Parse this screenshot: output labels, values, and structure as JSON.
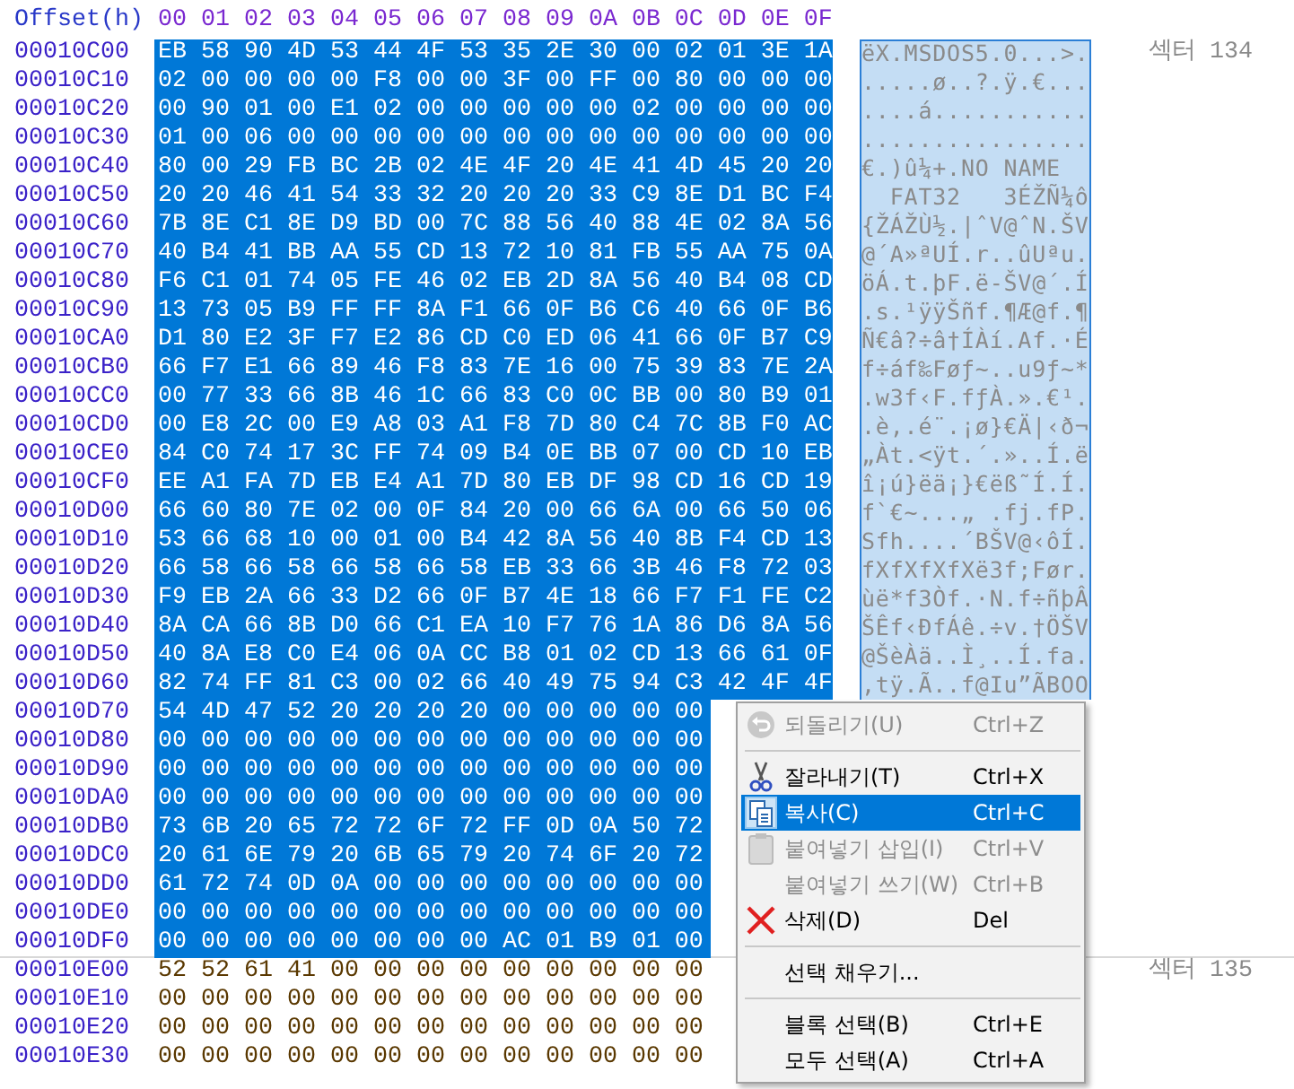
{
  "header": {
    "offset_label": "Offset(h)",
    "columns": [
      "00",
      "01",
      "02",
      "03",
      "04",
      "05",
      "06",
      "07",
      "08",
      "09",
      "0A",
      "0B",
      "0C",
      "0D",
      "0E",
      "0F"
    ]
  },
  "rows": [
    {
      "offset": "00010C00",
      "hex": [
        "EB",
        "58",
        "90",
        "4D",
        "53",
        "44",
        "4F",
        "53",
        "35",
        "2E",
        "30",
        "00",
        "02",
        "01",
        "3E",
        "1A"
      ],
      "ascii": "ëX.MSDOS5.0...>.",
      "selected": true,
      "sector": "섹터 134"
    },
    {
      "offset": "00010C10",
      "hex": [
        "02",
        "00",
        "00",
        "00",
        "00",
        "F8",
        "00",
        "00",
        "3F",
        "00",
        "FF",
        "00",
        "80",
        "00",
        "00",
        "00"
      ],
      "ascii": ".....ø..?.ÿ.€...",
      "selected": true
    },
    {
      "offset": "00010C20",
      "hex": [
        "00",
        "90",
        "01",
        "00",
        "E1",
        "02",
        "00",
        "00",
        "00",
        "00",
        "00",
        "02",
        "00",
        "00",
        "00",
        "00"
      ],
      "ascii": "....á...........",
      "selected": true
    },
    {
      "offset": "00010C30",
      "hex": [
        "01",
        "00",
        "06",
        "00",
        "00",
        "00",
        "00",
        "00",
        "00",
        "00",
        "00",
        "00",
        "00",
        "00",
        "00",
        "00"
      ],
      "ascii": "................",
      "selected": true
    },
    {
      "offset": "00010C40",
      "hex": [
        "80",
        "00",
        "29",
        "FB",
        "BC",
        "2B",
        "02",
        "4E",
        "4F",
        "20",
        "4E",
        "41",
        "4D",
        "45",
        "20",
        "20"
      ],
      "ascii": "€.)û¼+.NO NAME  ",
      "selected": true
    },
    {
      "offset": "00010C50",
      "hex": [
        "20",
        "20",
        "46",
        "41",
        "54",
        "33",
        "32",
        "20",
        "20",
        "20",
        "33",
        "C9",
        "8E",
        "D1",
        "BC",
        "F4"
      ],
      "ascii": "  FAT32   3ÉŽÑ¼ô",
      "selected": true
    },
    {
      "offset": "00010C60",
      "hex": [
        "7B",
        "8E",
        "C1",
        "8E",
        "D9",
        "BD",
        "00",
        "7C",
        "88",
        "56",
        "40",
        "88",
        "4E",
        "02",
        "8A",
        "56"
      ],
      "ascii": "{ŽÁŽÙ½.|ˆV@ˆN.ŠV",
      "selected": true
    },
    {
      "offset": "00010C70",
      "hex": [
        "40",
        "B4",
        "41",
        "BB",
        "AA",
        "55",
        "CD",
        "13",
        "72",
        "10",
        "81",
        "FB",
        "55",
        "AA",
        "75",
        "0A"
      ],
      "ascii": "@´A»ªUÍ.r..ûUªu.",
      "selected": true
    },
    {
      "offset": "00010C80",
      "hex": [
        "F6",
        "C1",
        "01",
        "74",
        "05",
        "FE",
        "46",
        "02",
        "EB",
        "2D",
        "8A",
        "56",
        "40",
        "B4",
        "08",
        "CD"
      ],
      "ascii": "öÁ.t.þF.ë-ŠV@´.Í",
      "selected": true
    },
    {
      "offset": "00010C90",
      "hex": [
        "13",
        "73",
        "05",
        "B9",
        "FF",
        "FF",
        "8A",
        "F1",
        "66",
        "0F",
        "B6",
        "C6",
        "40",
        "66",
        "0F",
        "B6"
      ],
      "ascii": ".s.¹ÿÿŠñf.¶Æ@f.¶",
      "selected": true
    },
    {
      "offset": "00010CA0",
      "hex": [
        "D1",
        "80",
        "E2",
        "3F",
        "F7",
        "E2",
        "86",
        "CD",
        "C0",
        "ED",
        "06",
        "41",
        "66",
        "0F",
        "B7",
        "C9"
      ],
      "ascii": "Ñ€â?÷â†ÍÀí.Af.·É",
      "selected": true
    },
    {
      "offset": "00010CB0",
      "hex": [
        "66",
        "F7",
        "E1",
        "66",
        "89",
        "46",
        "F8",
        "83",
        "7E",
        "16",
        "00",
        "75",
        "39",
        "83",
        "7E",
        "2A"
      ],
      "ascii": "f÷áf‰Føƒ~..u9ƒ~*",
      "selected": true
    },
    {
      "offset": "00010CC0",
      "hex": [
        "00",
        "77",
        "33",
        "66",
        "8B",
        "46",
        "1C",
        "66",
        "83",
        "C0",
        "0C",
        "BB",
        "00",
        "80",
        "B9",
        "01"
      ],
      "ascii": ".w3f‹F.fƒÀ.».€¹.",
      "selected": true
    },
    {
      "offset": "00010CD0",
      "hex": [
        "00",
        "E8",
        "2C",
        "00",
        "E9",
        "A8",
        "03",
        "A1",
        "F8",
        "7D",
        "80",
        "C4",
        "7C",
        "8B",
        "F0",
        "AC"
      ],
      "ascii": ".è,.é¨.¡ø}€Ä|‹ð¬",
      "selected": true
    },
    {
      "offset": "00010CE0",
      "hex": [
        "84",
        "C0",
        "74",
        "17",
        "3C",
        "FF",
        "74",
        "09",
        "B4",
        "0E",
        "BB",
        "07",
        "00",
        "CD",
        "10",
        "EB"
      ],
      "ascii": "„Àt.<ÿt.´.»..Í.ë",
      "selected": true
    },
    {
      "offset": "00010CF0",
      "hex": [
        "EE",
        "A1",
        "FA",
        "7D",
        "EB",
        "E4",
        "A1",
        "7D",
        "80",
        "EB",
        "DF",
        "98",
        "CD",
        "16",
        "CD",
        "19"
      ],
      "ascii": "î¡ú}ëä¡}€ëß˜Í.Í.",
      "selected": true
    },
    {
      "offset": "00010D00",
      "hex": [
        "66",
        "60",
        "80",
        "7E",
        "02",
        "00",
        "0F",
        "84",
        "20",
        "00",
        "66",
        "6A",
        "00",
        "66",
        "50",
        "06"
      ],
      "ascii": "f`€~...„ .fj.fP.",
      "selected": true
    },
    {
      "offset": "00010D10",
      "hex": [
        "53",
        "66",
        "68",
        "10",
        "00",
        "01",
        "00",
        "B4",
        "42",
        "8A",
        "56",
        "40",
        "8B",
        "F4",
        "CD",
        "13"
      ],
      "ascii": "Sfh....´BŠV@‹ôÍ.",
      "selected": true
    },
    {
      "offset": "00010D20",
      "hex": [
        "66",
        "58",
        "66",
        "58",
        "66",
        "58",
        "66",
        "58",
        "EB",
        "33",
        "66",
        "3B",
        "46",
        "F8",
        "72",
        "03"
      ],
      "ascii": "fXfXfXfXë3f;Før.",
      "selected": true
    },
    {
      "offset": "00010D30",
      "hex": [
        "F9",
        "EB",
        "2A",
        "66",
        "33",
        "D2",
        "66",
        "0F",
        "B7",
        "4E",
        "18",
        "66",
        "F7",
        "F1",
        "FE",
        "C2"
      ],
      "ascii": "ùë*f3Òf.·N.f÷ñþÂ",
      "selected": true
    },
    {
      "offset": "00010D40",
      "hex": [
        "8A",
        "CA",
        "66",
        "8B",
        "D0",
        "66",
        "C1",
        "EA",
        "10",
        "F7",
        "76",
        "1A",
        "86",
        "D6",
        "8A",
        "56"
      ],
      "ascii": "ŠÊf‹ÐfÁê.÷v.†ÖŠV",
      "selected": true
    },
    {
      "offset": "00010D50",
      "hex": [
        "40",
        "8A",
        "E8",
        "C0",
        "E4",
        "06",
        "0A",
        "CC",
        "B8",
        "01",
        "02",
        "CD",
        "13",
        "66",
        "61",
        "0F"
      ],
      "ascii": "@ŠèÀä..Ì¸..Í.fa.",
      "selected": true
    },
    {
      "offset": "00010D60",
      "hex": [
        "82",
        "74",
        "FF",
        "81",
        "C3",
        "00",
        "02",
        "66",
        "40",
        "49",
        "75",
        "94",
        "C3",
        "42",
        "4F",
        "4F"
      ],
      "ascii": "‚tÿ.Ã..f@Iu”ÃBOO",
      "selected": true
    },
    {
      "offset": "00010D70",
      "hex": [
        "54",
        "4D",
        "47",
        "52",
        "20",
        "20",
        "20",
        "20",
        "00",
        "00",
        "00",
        "00",
        "00"
      ],
      "selected": true
    },
    {
      "offset": "00010D80",
      "hex": [
        "00",
        "00",
        "00",
        "00",
        "00",
        "00",
        "00",
        "00",
        "00",
        "00",
        "00",
        "00",
        "00"
      ],
      "selected": true
    },
    {
      "offset": "00010D90",
      "hex": [
        "00",
        "00",
        "00",
        "00",
        "00",
        "00",
        "00",
        "00",
        "00",
        "00",
        "00",
        "00",
        "00"
      ],
      "selected": true
    },
    {
      "offset": "00010DA0",
      "hex": [
        "00",
        "00",
        "00",
        "00",
        "00",
        "00",
        "00",
        "00",
        "00",
        "00",
        "00",
        "00",
        "00"
      ],
      "selected": true
    },
    {
      "offset": "00010DB0",
      "hex": [
        "73",
        "6B",
        "20",
        "65",
        "72",
        "72",
        "6F",
        "72",
        "FF",
        "0D",
        "0A",
        "50",
        "72"
      ],
      "selected": true
    },
    {
      "offset": "00010DC0",
      "hex": [
        "20",
        "61",
        "6E",
        "79",
        "20",
        "6B",
        "65",
        "79",
        "20",
        "74",
        "6F",
        "20",
        "72"
      ],
      "selected": true
    },
    {
      "offset": "00010DD0",
      "hex": [
        "61",
        "72",
        "74",
        "0D",
        "0A",
        "00",
        "00",
        "00",
        "00",
        "00",
        "00",
        "00",
        "00"
      ],
      "selected": true
    },
    {
      "offset": "00010DE0",
      "hex": [
        "00",
        "00",
        "00",
        "00",
        "00",
        "00",
        "00",
        "00",
        "00",
        "00",
        "00",
        "00",
        "00"
      ],
      "selected": true
    },
    {
      "offset": "00010DF0",
      "hex": [
        "00",
        "00",
        "00",
        "00",
        "00",
        "00",
        "00",
        "00",
        "AC",
        "01",
        "B9",
        "01",
        "00"
      ],
      "selected": true
    },
    {
      "offset": "00010E00",
      "hex": [
        "52",
        "52",
        "61",
        "41",
        "00",
        "00",
        "00",
        "00",
        "00",
        "00",
        "00",
        "00",
        "00"
      ],
      "selected": false,
      "sector": "섹터 135"
    },
    {
      "offset": "00010E10",
      "hex": [
        "00",
        "00",
        "00",
        "00",
        "00",
        "00",
        "00",
        "00",
        "00",
        "00",
        "00",
        "00",
        "00"
      ],
      "selected": false
    },
    {
      "offset": "00010E20",
      "hex": [
        "00",
        "00",
        "00",
        "00",
        "00",
        "00",
        "00",
        "00",
        "00",
        "00",
        "00",
        "00",
        "00"
      ],
      "selected": false
    },
    {
      "offset": "00010E30",
      "hex": [
        "00",
        "00",
        "00",
        "00",
        "00",
        "00",
        "00",
        "00",
        "00",
        "00",
        "00",
        "00",
        "00"
      ],
      "selected": false
    }
  ],
  "context_menu": {
    "items": [
      {
        "kind": "item",
        "label": "되돌리기(U)",
        "shortcut": "Ctrl+Z",
        "disabled": true,
        "selected": false
      },
      {
        "kind": "separator"
      },
      {
        "kind": "item",
        "label": "잘라내기(T)",
        "shortcut": "Ctrl+X",
        "disabled": false,
        "selected": false
      },
      {
        "kind": "item",
        "label": "복사(C)",
        "shortcut": "Ctrl+C",
        "disabled": false,
        "selected": true
      },
      {
        "kind": "item",
        "label": "붙여넣기 삽입(I)",
        "shortcut": "Ctrl+V",
        "disabled": true,
        "selected": false
      },
      {
        "kind": "item",
        "label": "붙여넣기 쓰기(W)",
        "shortcut": "Ctrl+B",
        "disabled": true,
        "selected": false
      },
      {
        "kind": "item",
        "label": "삭제(D)",
        "shortcut": "Del",
        "disabled": false,
        "selected": false
      },
      {
        "kind": "separator"
      },
      {
        "kind": "item",
        "label": "선택 채우기...",
        "disabled": false,
        "selected": false
      },
      {
        "kind": "separator"
      },
      {
        "kind": "item",
        "label": "블록 선택(B)",
        "shortcut": "Ctrl+E",
        "disabled": false,
        "selected": false
      },
      {
        "kind": "item",
        "label": "모두 선택(A)",
        "shortcut": "Ctrl+A",
        "disabled": false,
        "selected": false
      }
    ]
  }
}
